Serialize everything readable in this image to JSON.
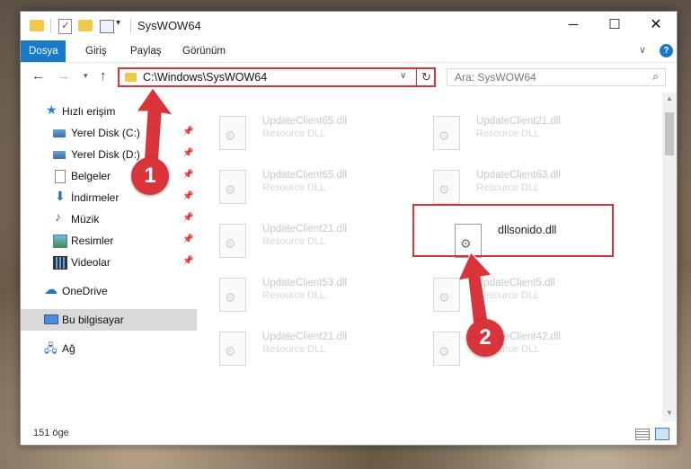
{
  "window": {
    "title": "SysWOW64",
    "minimize": "─",
    "maximize": "☐",
    "close": "✕"
  },
  "ribbon": {
    "tabs": [
      "Dosya",
      "Giriş",
      "Paylaş",
      "Görünüm"
    ],
    "help": "?"
  },
  "nav": {
    "address": "C:\\Windows\\SysWOW64",
    "search_placeholder": "Ara: SysWOW64"
  },
  "sidebar": {
    "items": [
      {
        "label": "Hızlı erişim",
        "icon": "star-icon",
        "pinned": false
      },
      {
        "label": "Yerel Disk (C:)",
        "icon": "drive-icon",
        "pinned": true
      },
      {
        "label": "Yerel Disk (D:)",
        "icon": "drive-icon",
        "pinned": true
      },
      {
        "label": "Belgeler",
        "icon": "documents-icon",
        "pinned": true
      },
      {
        "label": "İndirmeler",
        "icon": "downloads-icon",
        "pinned": true
      },
      {
        "label": "Müzik",
        "icon": "music-icon",
        "pinned": true
      },
      {
        "label": "Resimler",
        "icon": "pictures-icon",
        "pinned": true
      },
      {
        "label": "Videolar",
        "icon": "videos-icon",
        "pinned": true
      },
      {
        "label": "OneDrive",
        "icon": "cloud-icon",
        "pinned": false
      },
      {
        "label": "Bu bilgisayar",
        "icon": "computer-icon",
        "pinned": false,
        "selected": true
      },
      {
        "label": "Ağ",
        "icon": "network-icon",
        "pinned": false
      }
    ]
  },
  "files": [
    {
      "name": "UpdateClient65.dll",
      "type": "Resource DLL"
    },
    {
      "name": "UpdateClient21.dll",
      "type": "Resource DLL"
    },
    {
      "name": "UpdateClient65.dll",
      "type": "Resource DLL"
    },
    {
      "name": "UpdateClient63.dll",
      "type": "Resource DLL"
    },
    {
      "name": "UpdateClient21.dll",
      "type": "Resource DLL"
    },
    {
      "name": "dllsonido.dll",
      "type": "",
      "highlighted": true
    },
    {
      "name": "UpdateClient53.dll",
      "type": "Resource DLL"
    },
    {
      "name": "UpdateClient5.dll",
      "type": "Resource DLL"
    },
    {
      "name": "UpdateClient21.dll",
      "type": "Resource DLL"
    },
    {
      "name": "UpdateClient42.dll",
      "type": "Resource DLL"
    }
  ],
  "status": {
    "count": "151 öge"
  },
  "annotations": {
    "step1": "1",
    "step2": "2",
    "color": "#d9343b"
  }
}
